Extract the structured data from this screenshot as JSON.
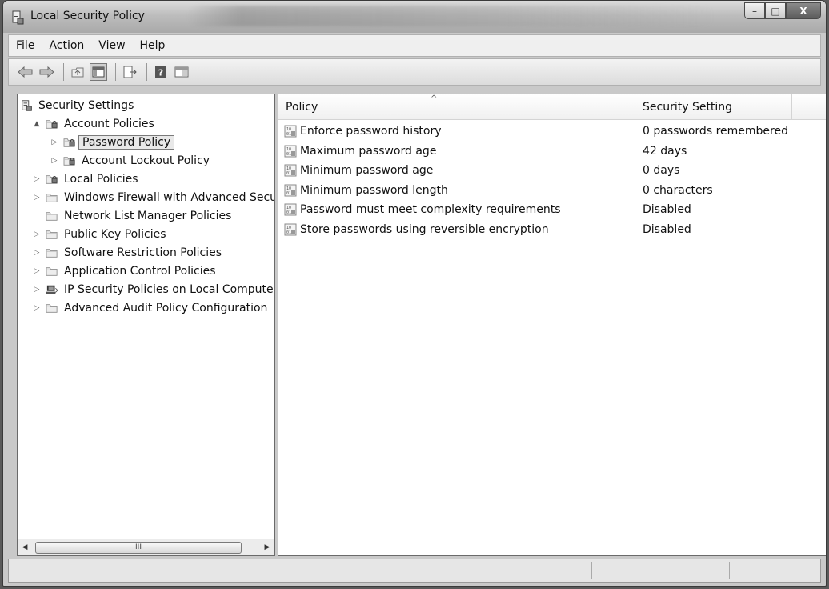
{
  "window": {
    "title": "Local Security Policy"
  },
  "titlebar": {
    "minimize": "–",
    "maximize": "□",
    "close": "X"
  },
  "menu": [
    "File",
    "Action",
    "View",
    "Help"
  ],
  "toolbar": {
    "icons": [
      "back-icon",
      "forward-icon",
      "up-folder-icon",
      "show-hide-tree-icon",
      "export-list-icon",
      "help-icon",
      "properties-icon"
    ]
  },
  "tree": {
    "root": "Security Settings",
    "items": [
      {
        "label": "Account Policies",
        "level": 1,
        "expander": "▲",
        "icon": "lock-folder-icon"
      },
      {
        "label": "Password Policy",
        "level": 2,
        "expander": "▷",
        "icon": "lock-folder-icon",
        "selected": true
      },
      {
        "label": "Account Lockout Policy",
        "level": 2,
        "expander": "▷",
        "icon": "lock-folder-icon"
      },
      {
        "label": "Local Policies",
        "level": 1,
        "expander": "▷",
        "icon": "lock-folder-icon"
      },
      {
        "label": "Windows Firewall with Advanced Secu",
        "level": 1,
        "expander": "▷",
        "icon": "folder-icon"
      },
      {
        "label": "Network List Manager Policies",
        "level": 1,
        "expander": "",
        "icon": "folder-icon"
      },
      {
        "label": "Public Key Policies",
        "level": 1,
        "expander": "▷",
        "icon": "folder-icon"
      },
      {
        "label": "Software Restriction Policies",
        "level": 1,
        "expander": "▷",
        "icon": "folder-icon"
      },
      {
        "label": "Application Control Policies",
        "level": 1,
        "expander": "▷",
        "icon": "folder-icon"
      },
      {
        "label": "IP Security Policies on Local Compute",
        "level": 1,
        "expander": "▷",
        "icon": "network-computer-icon"
      },
      {
        "label": "Advanced Audit Policy Configuration",
        "level": 1,
        "expander": "▷",
        "icon": "folder-icon"
      }
    ],
    "scroll": {
      "left": "◀",
      "right": "▶",
      "thumb": "III"
    }
  },
  "list": {
    "columns": [
      "Policy",
      "Security Setting"
    ],
    "sort_indicator": "^",
    "rows": [
      {
        "policy": "Enforce password history",
        "setting": "0 passwords remembered"
      },
      {
        "policy": "Maximum password age",
        "setting": "42 days"
      },
      {
        "policy": "Minimum password age",
        "setting": "0 days"
      },
      {
        "policy": "Minimum password length",
        "setting": "0 characters"
      },
      {
        "policy": "Password must meet complexity requirements",
        "setting": "Disabled"
      },
      {
        "policy": "Store passwords using reversible encryption",
        "setting": "Disabled"
      }
    ]
  }
}
